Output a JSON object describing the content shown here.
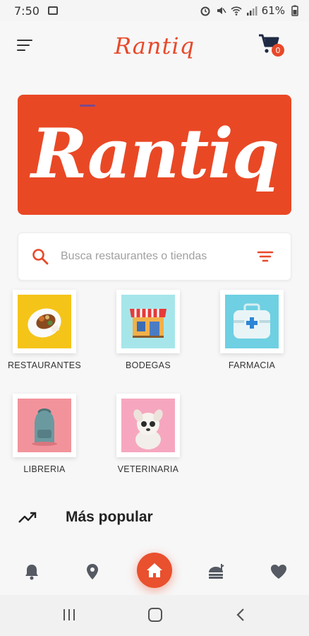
{
  "status_bar": {
    "time": "7:50",
    "battery": "61%"
  },
  "header": {
    "brand": "Rantiq",
    "cart_count": "0"
  },
  "banner": {
    "text": "Rantiq"
  },
  "search": {
    "placeholder": "Busca restaurantes o tiendas"
  },
  "categories": [
    {
      "label": "RESTAURANTES",
      "bg": "#f5c419"
    },
    {
      "label": "BODEGAS",
      "bg": "#a6e6ea"
    },
    {
      "label": "FARMACIA",
      "bg": "#6ed0e2"
    },
    {
      "label": "LIBRERIA",
      "bg": "#f2939b"
    },
    {
      "label": "VETERINARIA",
      "bg": "#f6a7bf"
    }
  ],
  "popular": {
    "title": "Más popular"
  },
  "colors": {
    "accent": "#e8492a",
    "text": "#222222",
    "icon": "#555a63"
  }
}
